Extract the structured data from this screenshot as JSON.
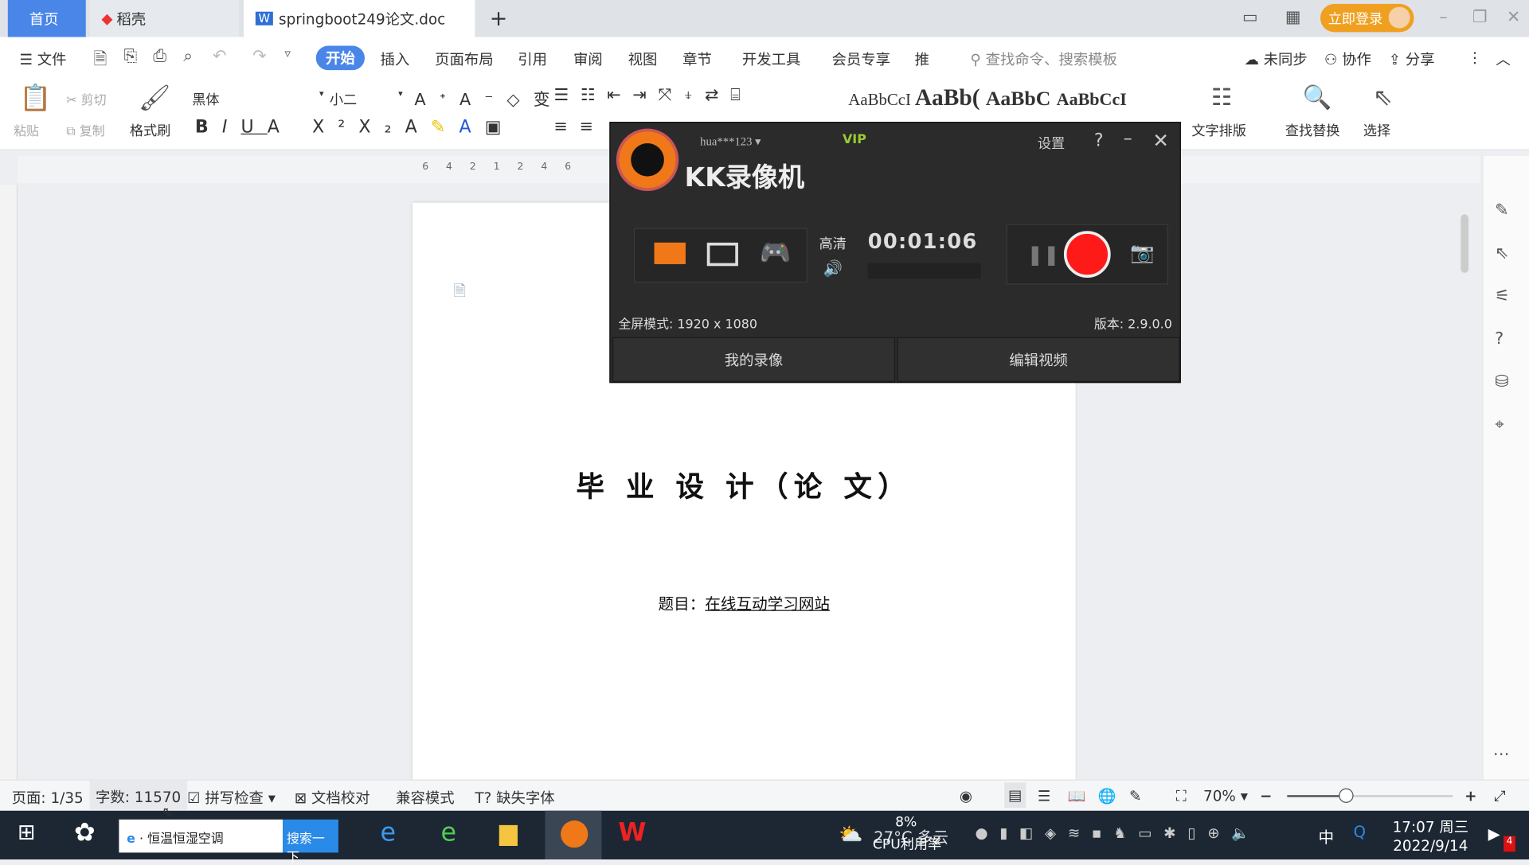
{
  "tabs": {
    "home": "首页",
    "daoke": "稻壳",
    "doc": "springboot249论文.doc",
    "new": "+"
  },
  "titlebar": {
    "login": "立即登录"
  },
  "menu": {
    "file": "文件",
    "items": [
      "开始",
      "插入",
      "页面布局",
      "引用",
      "审阅",
      "视图",
      "章节",
      "开发工具",
      "会员专享",
      "推"
    ],
    "search_placeholder": "查找命令、搜索模板",
    "sync": "未同步",
    "collab": "协作",
    "share": "分享"
  },
  "toolbar": {
    "paste": "粘贴",
    "cut": "剪切",
    "copy": "复制",
    "format_painter": "格式刷",
    "font": "黑体",
    "size": "小二",
    "styles": [
      "AaBbCcI",
      "AaBb(",
      "AaBbC",
      "AaBbCcI"
    ],
    "text_layout": "文字排版",
    "find_replace": "查找替换",
    "select": "选择"
  },
  "document": {
    "title": "毕 业 设 计（论 文）",
    "subject_label": "题目：",
    "subject": "在线互动学习网站"
  },
  "recorder": {
    "user": "hua***123",
    "vip": "VIP",
    "settings": "设置",
    "help": "?",
    "name": "KK录像机",
    "quality": "高清",
    "timer": "00:01:06",
    "mode": "全屏模式: 1920 x 1080",
    "version": "版本: 2.9.0.0",
    "my_recordings": "我的录像",
    "edit_video": "编辑视频"
  },
  "status": {
    "page": "页面: 1/35",
    "words": "字数: 11570",
    "spell": "拼写检查",
    "proof": "文档校对",
    "compat": "兼容模式",
    "missing_font": "缺失字体",
    "zoom": "70%",
    "zoom_level": 0.35
  },
  "taskbar": {
    "search_text": "恒温恒湿空调",
    "search_btn": "搜索一下",
    "cpu": "8%",
    "cpu_label": "CPU利用率",
    "weather": "27°C 多云",
    "ime": "中",
    "time": "17:07 周三",
    "date": "2022/9/14",
    "notif": "4"
  },
  "colors": {
    "accent": "#4a86e8",
    "login": "#f0a020",
    "record": "#ff1a1a",
    "kk_orange": "#f07818"
  }
}
